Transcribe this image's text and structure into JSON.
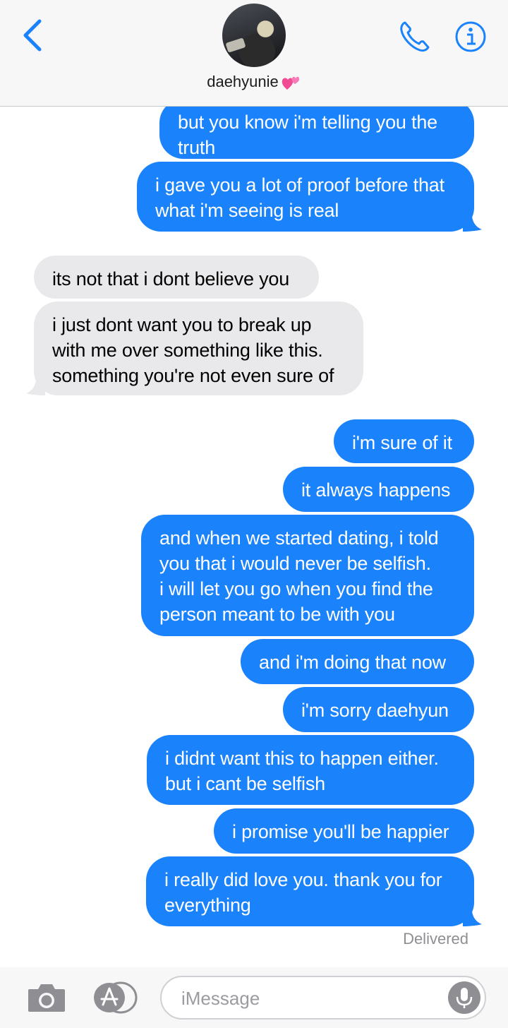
{
  "header": {
    "contact_name": "daehyunie",
    "contact_emoji": "two-hearts-icon",
    "back_icon": "chevron-left-icon",
    "call_icon": "phone-icon",
    "info_icon": "info-icon",
    "accent_color": "#1a82fb"
  },
  "messages": [
    {
      "side": "sent",
      "text": "but you know i'm telling you the\ntruth"
    },
    {
      "side": "sent",
      "text": "i gave you a lot of proof before that\nwhat i'm seeing is real"
    },
    {
      "side": "received",
      "text": "its not that i dont believe you"
    },
    {
      "side": "received",
      "text": "i just dont want you to break up\nwith me over something like this.\nsomething you're not even sure of"
    },
    {
      "side": "sent",
      "text": "i'm sure of it"
    },
    {
      "side": "sent",
      "text": "it always happens"
    },
    {
      "side": "sent",
      "text": "and when we started dating, i told\nyou that i would never be selfish.\ni will let you go when you find the\nperson meant to be with you"
    },
    {
      "side": "sent",
      "text": "and i'm doing that now"
    },
    {
      "side": "sent",
      "text": "i'm sorry daehyun"
    },
    {
      "side": "sent",
      "text": "i didnt want this to happen either.\nbut i cant be selfish"
    },
    {
      "side": "sent",
      "text": "i promise you'll be happier"
    },
    {
      "side": "sent",
      "text": "i really did love you. thank you for\neverything"
    }
  ],
  "delivered_status": "Delivered",
  "composer": {
    "placeholder": "iMessage",
    "camera_icon": "camera-icon",
    "apps_icon": "app-store-icon",
    "mic_icon": "microphone-icon"
  },
  "colors": {
    "sent_bubble": "#1a82fb",
    "received_bubble": "#e9e9eb",
    "status_text": "#8e8e93"
  }
}
